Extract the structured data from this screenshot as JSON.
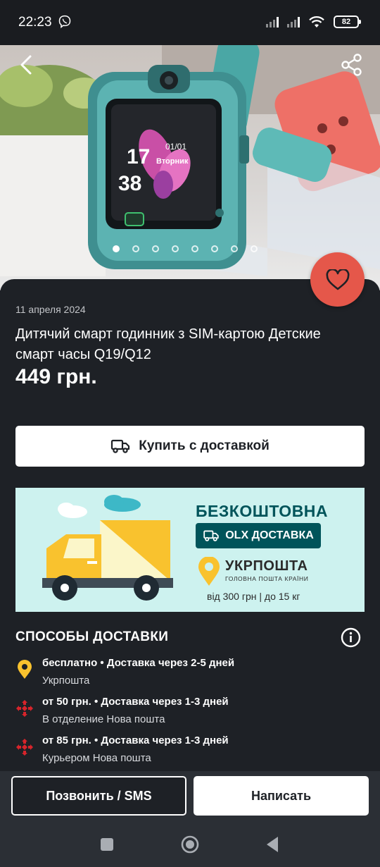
{
  "status_bar": {
    "time": "22:23",
    "battery": "82",
    "icons": [
      "viber-icon",
      "signal-icon",
      "signal-icon",
      "wifi-icon",
      "battery-icon"
    ]
  },
  "hero": {
    "image_description_icon": "smart-watch-photo",
    "watch_screen": {
      "hour": "17",
      "minute": "38",
      "date": "01/01",
      "day": "Вторник"
    },
    "slides_total": 8,
    "active_slide": 1
  },
  "listing": {
    "date": "11 апреля 2024",
    "title": "Дитячий смарт годинник з SIM-картою Детские смарт часы  Q19/Q12",
    "price": "449 грн."
  },
  "buy_button": {
    "label": "Купить с доставкой",
    "icon": "truck-icon"
  },
  "banner": {
    "headline": "БЕЗКОШТОВНА",
    "olx_label": "OLX ДОСТАВКА",
    "carrier": "УКРПОШТА",
    "carrier_sub": "ГОЛОВНА ПОШТА КРАЇНИ",
    "conditions": "від 300 грн | до 15 кг",
    "colors": {
      "background": "#cdf2ef",
      "dark": "#00545a",
      "yellow": "#f9c22e"
    }
  },
  "delivery": {
    "title": "СПОСОБЫ ДОСТАВКИ",
    "methods": [
      {
        "line1": "бесплатно • Доставка через 2-5 дней",
        "line2": "Укрпошта",
        "icon": "ukrposhta-icon"
      },
      {
        "line1": "от 50 грн. • Доставка через 1-3 дней",
        "line2": "В отделение Нова пошта",
        "icon": "nova-poshta-icon"
      },
      {
        "line1": "от 85 грн. • Доставка через 1-3 дней",
        "line2": "Курьером Нова пошта",
        "icon": "nova-poshta-icon"
      }
    ]
  },
  "actions": {
    "call_label": "Позвонить / SMS",
    "write_label": "Написать"
  },
  "colors": {
    "background": "#1e2126",
    "favorite": "#e5574a",
    "nova_poshta": "#d7242b",
    "ukrposhta": "#f9c22e"
  }
}
